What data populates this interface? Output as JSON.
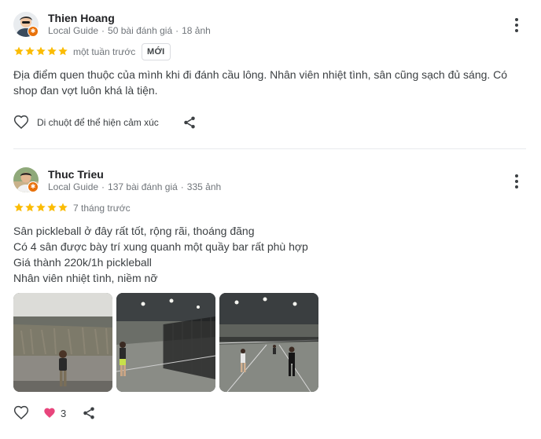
{
  "reviews": [
    {
      "author": "Thien Hoang",
      "badge": "Local Guide",
      "review_count": "50 bài đánh giá",
      "photo_count": "18 ảnh",
      "rating": 5,
      "time": "một tuần trước",
      "new_label": "MỚI",
      "text_lines": [
        "Địa điểm quen thuộc của mình khi đi đánh cầu lông. Nhân viên nhiệt tình, sân cũng sạch đủ sáng. Có",
        "shop đan vợt luôn khá là tiện."
      ],
      "hover_label": "Di chuột để thể hiện cảm xúc",
      "like_icon": "heart-outline-icon",
      "share_icon": "share-icon"
    },
    {
      "author": "Thuc Trieu",
      "badge": "Local Guide",
      "review_count": "137 bài đánh giá",
      "photo_count": "335 ảnh",
      "rating": 5,
      "time": "7 tháng trước",
      "text_lines": [
        "Sân pickleball ở đây rất tốt, rộng rãi, thoáng đãng",
        "Có 4 sân được bày trí xung quanh một quầy bar rất phù hợp",
        "Giá thành 220k/1h pickleball",
        "Nhân viên nhiệt tình, niềm nỡ"
      ],
      "photos": [
        "photo-player-wall",
        "photo-court-net",
        "photo-court-players"
      ],
      "reaction_count": "3",
      "like_icon": "heart-outline-icon",
      "share_icon": "share-icon"
    }
  ],
  "colors": {
    "star": "#fbbc04",
    "guide_badge": "#e8710a",
    "reaction_heart": "#e8457c",
    "meta_text": "#70757a"
  }
}
